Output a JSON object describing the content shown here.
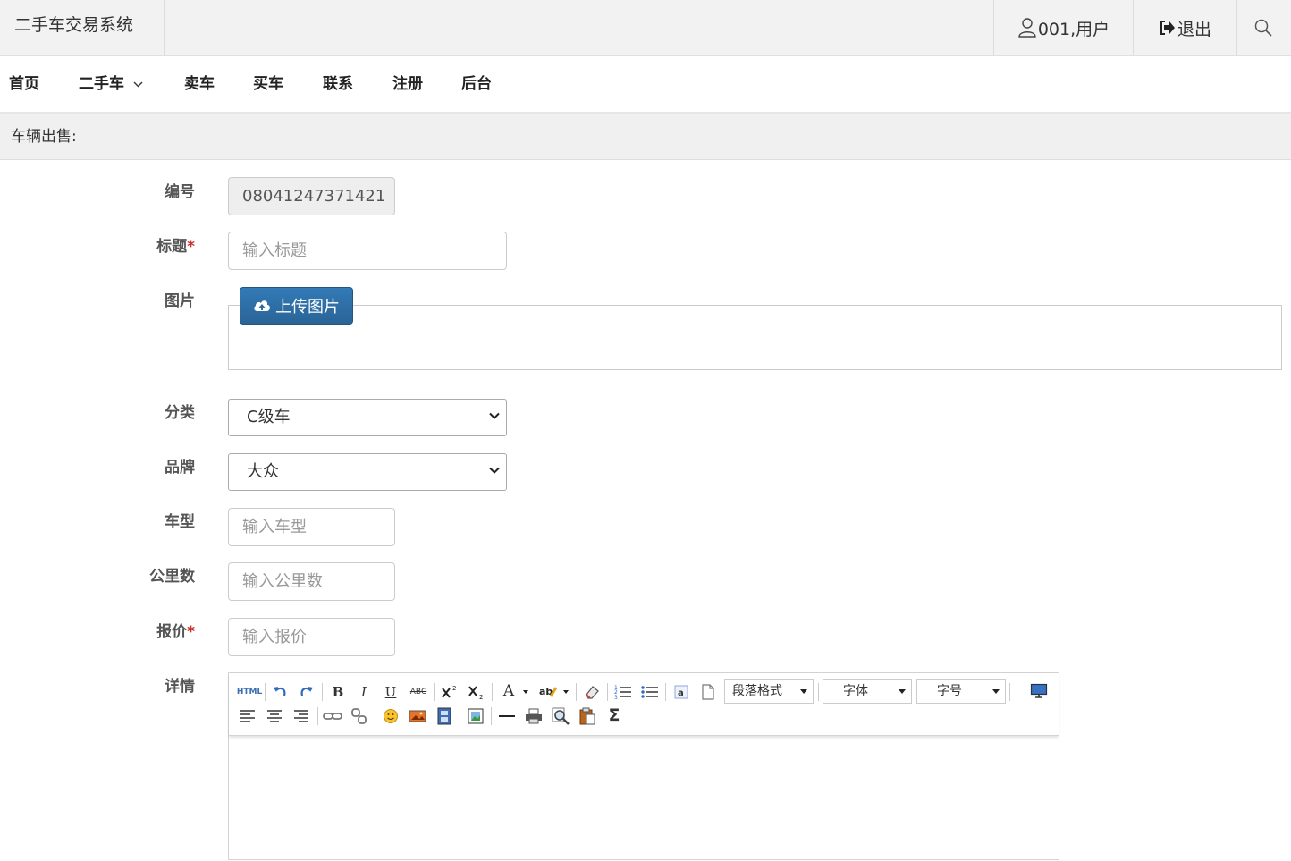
{
  "app": {
    "title": "二手车交易系统"
  },
  "topbar": {
    "user_label": "001,用户",
    "logout_label": "退出"
  },
  "nav": {
    "items": [
      "首页",
      "二手车",
      "卖车",
      "买车",
      "联系",
      "注册",
      "后台"
    ]
  },
  "section": {
    "title": "车辆出售:"
  },
  "form": {
    "id_label": "编号",
    "id_value": "08041247371421",
    "title_label": "标题",
    "title_placeholder": "输入标题",
    "image_label": "图片",
    "upload_label": "上传图片",
    "category_label": "分类",
    "category_value": "C级车",
    "brand_label": "品牌",
    "brand_value": "大众",
    "model_label": "车型",
    "model_placeholder": "输入车型",
    "mileage_label": "公里数",
    "mileage_placeholder": "输入公里数",
    "price_label": "报价",
    "price_placeholder": "输入报价",
    "detail_label": "详情",
    "required_mark": "*"
  },
  "editor": {
    "html_label": "HTML",
    "bold": "B",
    "italic": "I",
    "underline": "U",
    "strike": "ABC",
    "font_color": "A",
    "paragraph_label": "段落格式",
    "font_label": "字体",
    "size_label": "字号",
    "formula": "Σ"
  },
  "colors": {
    "primary": "#337ab7",
    "required": "#c9302c"
  }
}
